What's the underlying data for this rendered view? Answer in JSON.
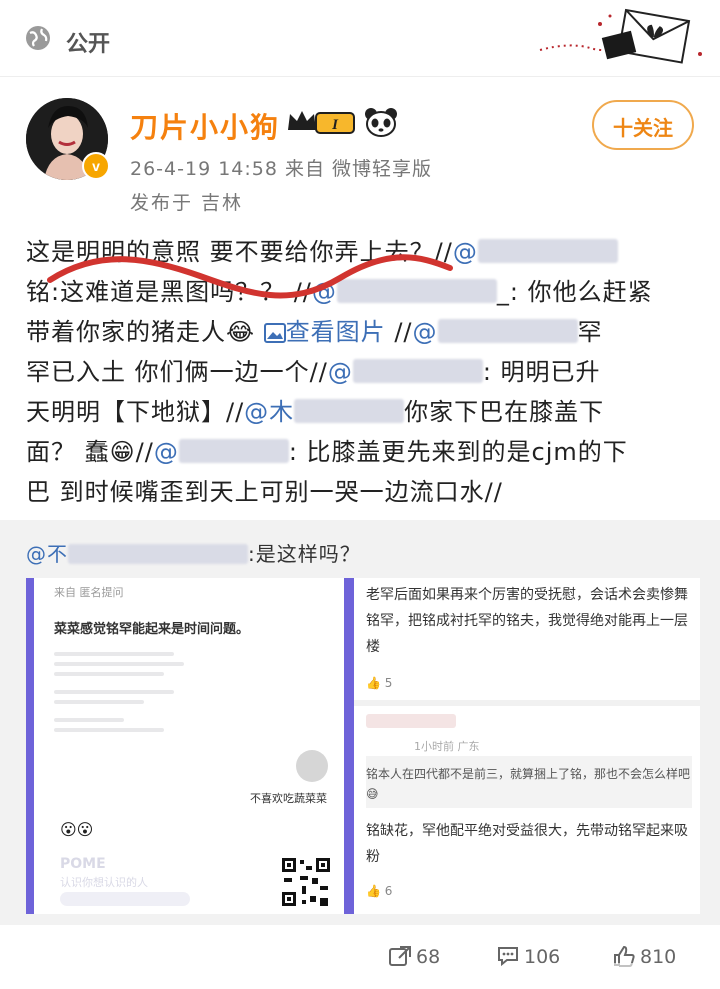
{
  "header": {
    "visibility": "公开"
  },
  "post": {
    "username": "刀片小小狗",
    "level_badge": "I",
    "verified_mark": "v",
    "time_source": "26-4-19 14:58  来自 微博轻享版",
    "location": "发布于 吉林",
    "follow_label": "十关注",
    "line1a": "这是明明的意照 要不要给你弄上去？//",
    "line1b": "@",
    "line2a": "铭:这难道是黑图吗？？ //",
    "line2b": "@",
    "line2c": "_: 你他么赶紧",
    "line3a": "带着你家的猪走人",
    "line3b": "查看图片",
    "line3c": " //",
    "line3d": "@",
    "line3e": "罕",
    "line4a": "罕已入土 你们俩一边一个//",
    "line4b": "@",
    "line4c": ": 明明已升",
    "line5a": "天明明【下地狱】//",
    "line5b": "@木",
    "line5c": "你家下巴在膝盖下",
    "line6a": "面？ 蠢",
    "line6b": "//",
    "line6c": "@",
    "line6d": ": 比膝盖更先来到的是cjm的下",
    "line7": "巴 到时候嘴歪到天上可别一哭一边流口水//"
  },
  "retweet": {
    "author_prefix": "@不",
    "text": ":是这样吗？",
    "left_panel": {
      "from": "来自 匿名提问",
      "title": "菜菜感觉铭罕能起来是时间问题。",
      "user": "不喜欢吃蔬菜菜",
      "emoji": "😮😮",
      "pome": "POME",
      "pome_sub": "认识你想认识的人"
    },
    "right_panel": {
      "comment1": "老罕后面如果再来个厉害的受抚慰，会话术会卖惨舞铭罕，把铭成衬托罕的铭夫，我觉得绝对能再上一层楼",
      "likes1": "5",
      "time2": "1小时前 广东",
      "quote2": "铭本人在四代都不是前三，就算捆上了铭，那也不会怎么样吧😅",
      "comment2": "铭缺花，罕他配平绝对受益很大，先带动铭罕起来吸粉",
      "likes2": "6"
    }
  },
  "actions": {
    "repost": "68",
    "comment": "106",
    "like": "810"
  },
  "colors": {
    "brand": "#f5810f",
    "link": "#3d6fb6",
    "accent_purple": "#6e63d9"
  }
}
